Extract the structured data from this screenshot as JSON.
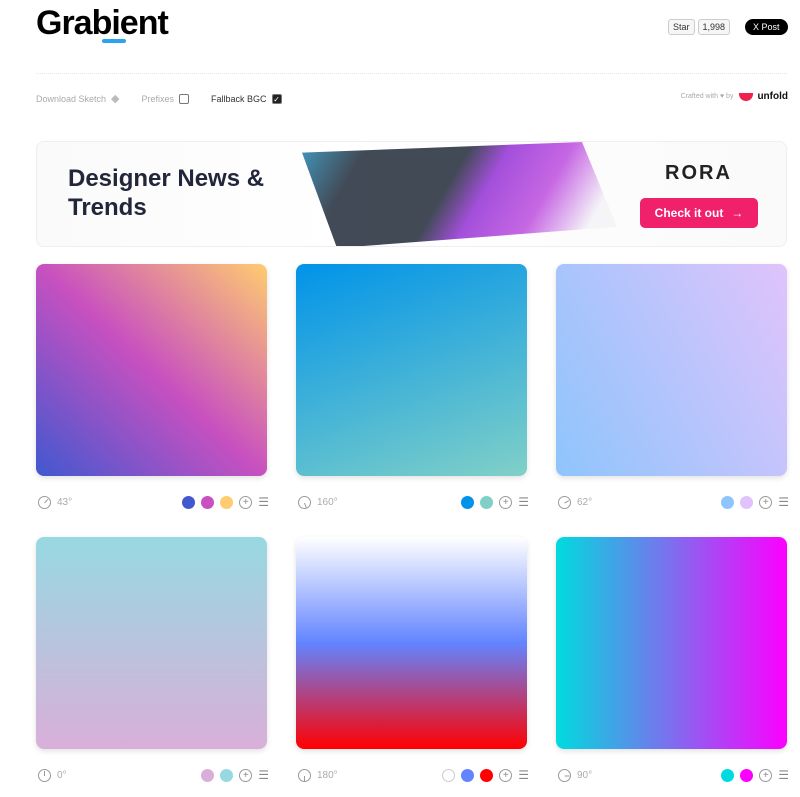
{
  "header": {
    "logo": "Grabient",
    "github_star": "Star",
    "github_count": "1,998",
    "x_post": "X Post"
  },
  "options": {
    "download": "Download Sketch",
    "prefixes": "Prefixes",
    "fallback": "Fallback BGC",
    "fallback_checked": true,
    "prefixes_checked": false,
    "check": "✓"
  },
  "crafted": {
    "text": "Crafted with ♥ by",
    "brand": "unfold"
  },
  "ad": {
    "title": "Designer News & Trends",
    "brand": "RORA",
    "button": "Check it out",
    "arrow": "→",
    "button_color": "#f0216a"
  },
  "gradients": [
    {
      "angle": "43°",
      "deg": 43,
      "colors": [
        "#4158D0",
        "#C850C0",
        "#FFCC70"
      ]
    },
    {
      "angle": "160°",
      "deg": 160,
      "colors": [
        "#0093E9",
        "#80D0C7"
      ]
    },
    {
      "angle": "62°",
      "deg": 62,
      "colors": [
        "#8EC5FC",
        "#E0C3FC"
      ]
    },
    {
      "angle": "0°",
      "deg": 0,
      "colors": [
        "#D9AFD9",
        "#97D9E1"
      ]
    },
    {
      "angle": "180°",
      "deg": 180,
      "colors": [
        "#FFFFFF",
        "#6284FF",
        "#FF0000"
      ]
    },
    {
      "angle": "90°",
      "deg": 90,
      "colors": [
        "#00DBDE",
        "#FC00FF"
      ]
    }
  ],
  "icons": {
    "add": "+",
    "settings": "☰"
  }
}
